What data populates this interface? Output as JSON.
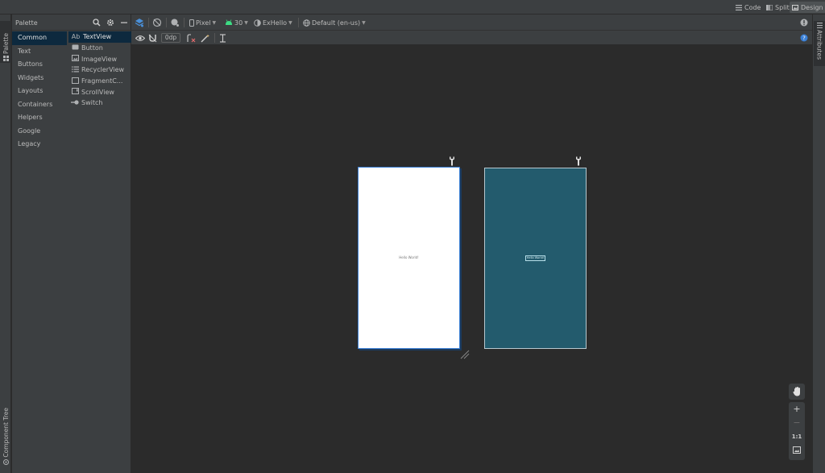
{
  "view_modes": {
    "code_label": "Code",
    "split_label": "Split",
    "design_label": "Design",
    "active": "Design"
  },
  "side_tabs": {
    "palette": "Palette",
    "component_tree": "Component Tree",
    "attributes": "Attributes"
  },
  "palette": {
    "title": "Palette",
    "categories": [
      "Common",
      "Text",
      "Buttons",
      "Widgets",
      "Layouts",
      "Containers",
      "Helpers",
      "Google",
      "Legacy"
    ],
    "selected_category": "Common",
    "widgets": [
      {
        "label": "TextView",
        "icon_text": "Ab",
        "icon": "textview-icon"
      },
      {
        "label": "Button",
        "icon": "button-icon"
      },
      {
        "label": "ImageView",
        "icon": "imageview-icon"
      },
      {
        "label": "RecyclerView",
        "icon": "recyclerview-icon"
      },
      {
        "label": "FragmentC...",
        "icon": "fragment-icon"
      },
      {
        "label": "ScrollView",
        "icon": "scrollview-icon"
      },
      {
        "label": "Switch",
        "icon": "switch-icon"
      }
    ],
    "selected_widget": "TextView"
  },
  "toolbar": {
    "device": "Pixel",
    "api_level": "30",
    "theme": "ExHello",
    "locale": "Default (en-us)",
    "default_margin": "0dp"
  },
  "canvas": {
    "design_text": "Hello World!",
    "blueprint_text": "Hello World!"
  },
  "zoom": {
    "actual_size_label": "1:1"
  },
  "colors": {
    "selection": "#0d293e",
    "blueprint_bg": "#235b6d",
    "accent": "#3a7fd5",
    "android_green": "#3ddc84"
  }
}
